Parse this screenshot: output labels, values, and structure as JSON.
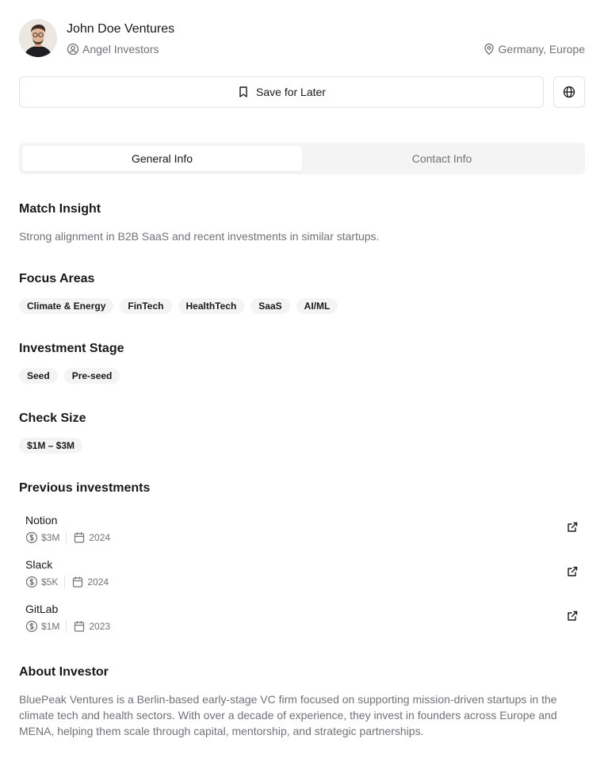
{
  "profile": {
    "name": "John Doe Ventures",
    "type": "Angel Investors",
    "location": "Germany, Europe"
  },
  "actions": {
    "save_label": "Save for Later"
  },
  "tabs": [
    {
      "label": "General Info",
      "active": true
    },
    {
      "label": "Contact Info",
      "active": false
    }
  ],
  "match_insight": {
    "title": "Match Insight",
    "text": "Strong alignment in B2B SaaS and recent investments in similar startups."
  },
  "focus_areas": {
    "title": "Focus Areas",
    "tags": [
      "Climate & Energy",
      "FinTech",
      "HealthTech",
      "SaaS",
      "AI/ML"
    ]
  },
  "investment_stage": {
    "title": "Investment Stage",
    "tags": [
      "Seed",
      "Pre-seed"
    ]
  },
  "check_size": {
    "title": "Check Size",
    "value": "$1M – $3M"
  },
  "previous_investments": {
    "title": "Previous investments",
    "items": [
      {
        "name": "Notion",
        "amount": "$3M",
        "year": "2024"
      },
      {
        "name": "Slack",
        "amount": "$5K",
        "year": "2024"
      },
      {
        "name": "GitLab",
        "amount": "$1M",
        "year": "2023"
      }
    ]
  },
  "about": {
    "title": "About Investor",
    "text": "BluePeak Ventures is a Berlin-based early-stage VC firm focused on supporting mission-driven startups in the climate tech and health sectors. With over a decade of experience, they invest in founders across Europe and MENA, helping them scale through capital, mentorship, and strategic partnerships."
  },
  "icons": {
    "type": "user-circle-icon",
    "location": "map-pin-icon",
    "save": "bookmark-icon",
    "web": "globe-icon",
    "amount": "dollar-circle-icon",
    "year": "calendar-icon",
    "link": "external-link-icon"
  },
  "colors": {
    "text": "#18181b",
    "muted": "#71717a",
    "border": "#e4e4e7",
    "tag_bg": "#f4f4f5"
  }
}
